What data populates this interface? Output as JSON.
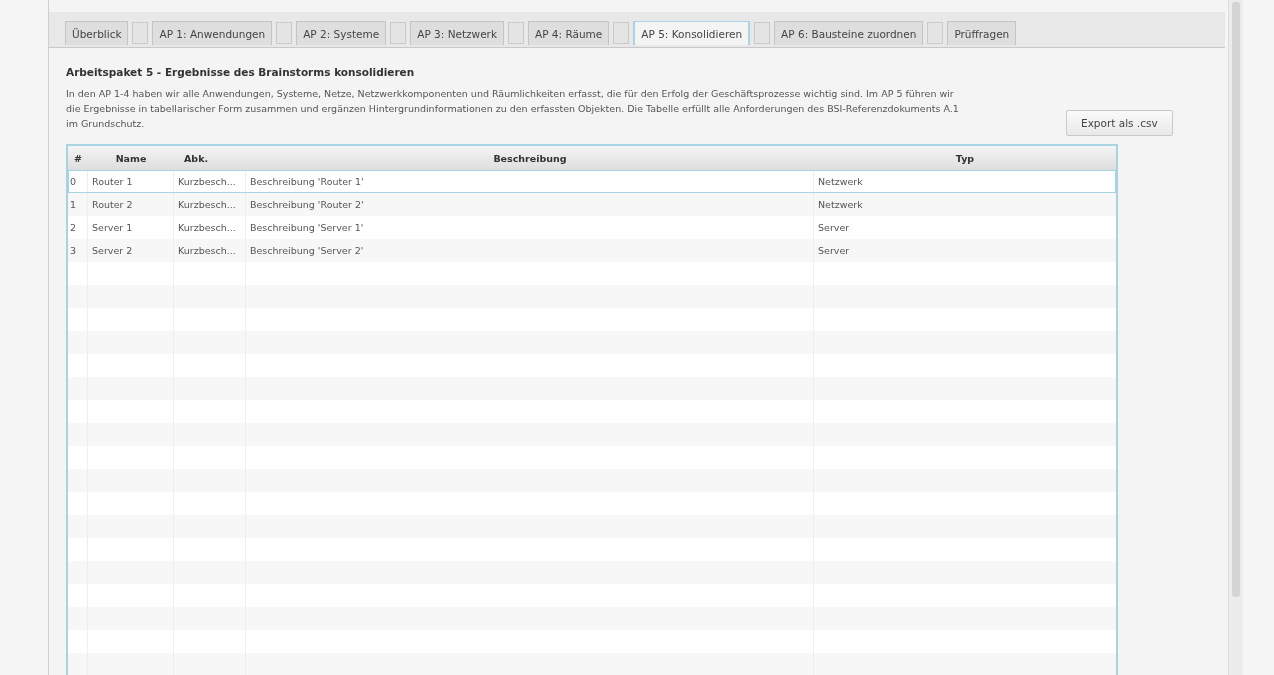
{
  "tabs": [
    {
      "label": "Überblick",
      "kind": "plain",
      "selected": false
    },
    {
      "label": "AP 1: Anwendungen",
      "kind": "checkbox",
      "checked": false,
      "selected": false
    },
    {
      "label": "AP 2: Systeme",
      "kind": "checkbox",
      "checked": false,
      "selected": false
    },
    {
      "label": "AP 3: Netzwerk",
      "kind": "checkbox",
      "checked": false,
      "selected": false
    },
    {
      "label": "AP 4: Räume",
      "kind": "checkbox",
      "checked": false,
      "selected": false
    },
    {
      "label": "AP 5: Konsolidieren",
      "kind": "checkbox",
      "checked": false,
      "selected": true
    },
    {
      "label": "AP 6: Bausteine zuordnen",
      "kind": "checkbox",
      "checked": false,
      "selected": false
    },
    {
      "label": "Prüffragen",
      "kind": "checkbox",
      "checked": false,
      "selected": false
    }
  ],
  "heading": "Arbeitspaket 5 - Ergebnisse des Brainstorms konsolidieren",
  "description": "In den AP 1-4 haben wir alle Anwendungen, Systeme, Netze, Netzwerkkomponenten und Räumlichkeiten erfasst, die für den Erfolg der Geschäftsprozesse wichtig sind. Im AP 5 führen wir die Ergebnisse in tabellarischer Form zusammen und ergänzen Hintergrundinformationen zu den erfassten Objekten. Die Tabelle erfüllt alle Anforderungen des BSI-Referenzdokuments A.1 im Grundschutz.",
  "export_button": "Export als .csv",
  "table": {
    "columns": [
      "#",
      "Name",
      "Abk.",
      "Beschreibung",
      "Typ"
    ],
    "rows": [
      {
        "cells": [
          "0",
          "Router 1",
          "Kurzbesch...",
          "Beschreibung 'Router 1'",
          "Netzwerk"
        ],
        "selected": true
      },
      {
        "cells": [
          "1",
          "Router 2",
          "Kurzbesch...",
          "Beschreibung 'Router 2'",
          "Netzwerk"
        ],
        "selected": false
      },
      {
        "cells": [
          "2",
          "Server 1",
          "Kurzbesch...",
          "Beschreibung 'Server 1'",
          "Server"
        ],
        "selected": false
      },
      {
        "cells": [
          "3",
          "Server 2",
          "Kurzbesch...",
          "Beschreibung 'Server 2'",
          "Server"
        ],
        "selected": false
      }
    ]
  }
}
